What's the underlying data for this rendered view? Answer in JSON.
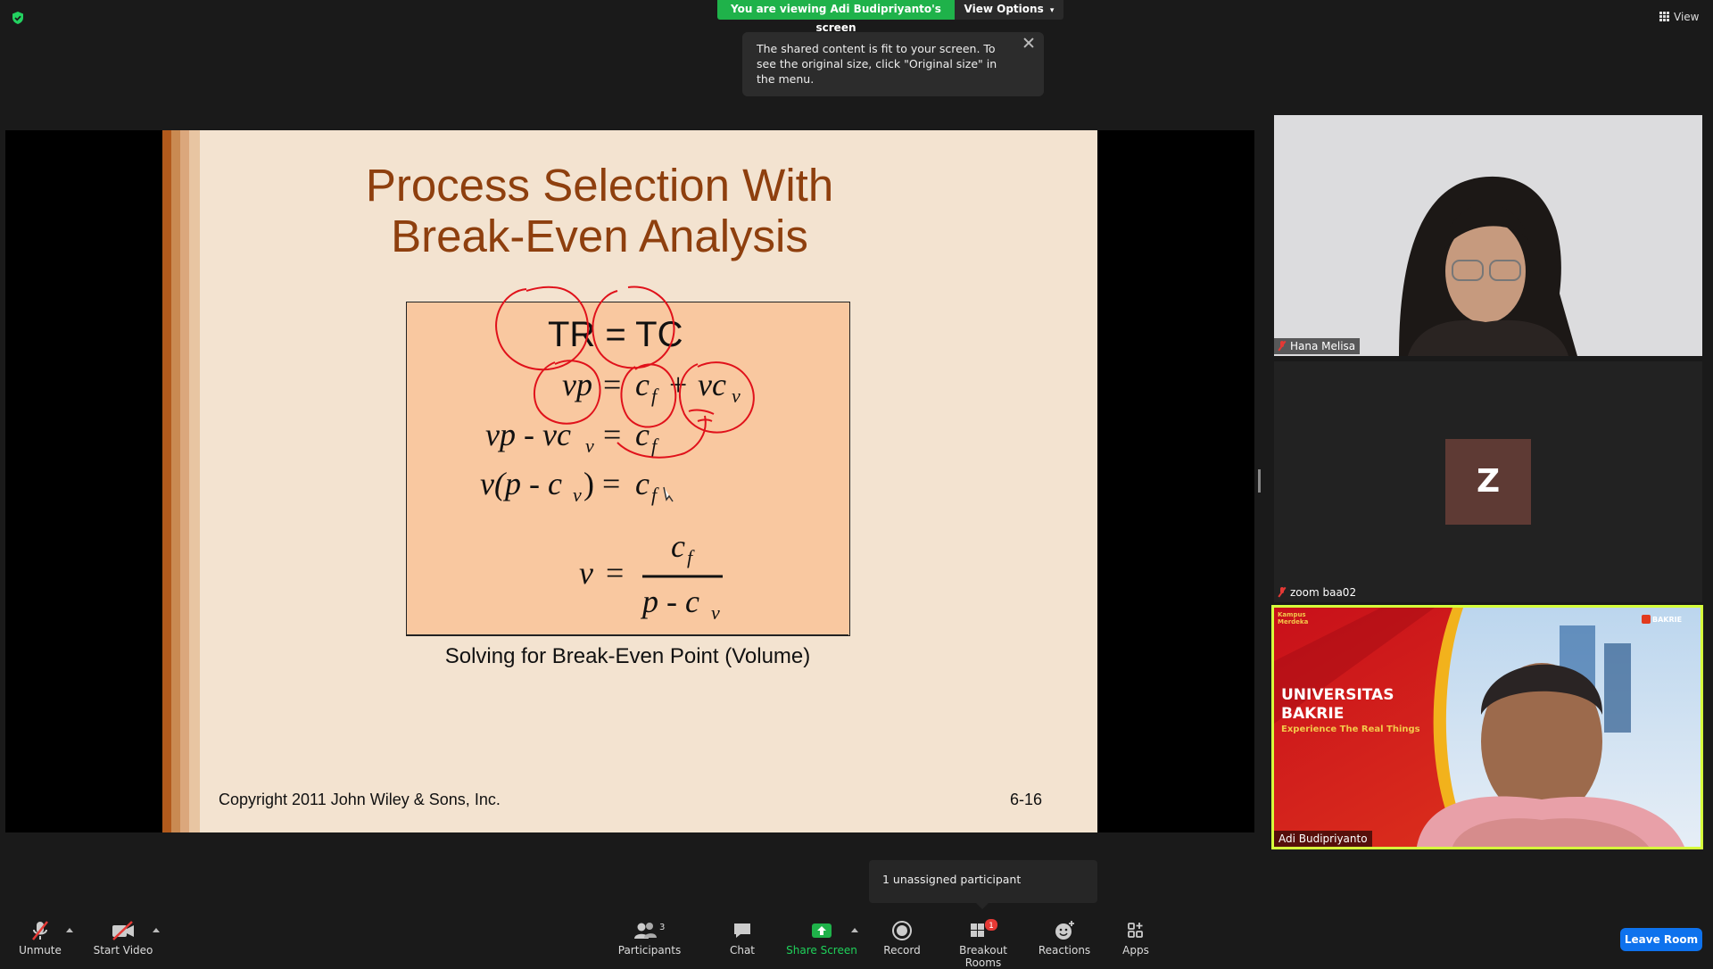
{
  "colors": {
    "background": "#1a1a1a",
    "banner_green": "#1fb24a",
    "active_speaker_border": "#d6ff3b",
    "leave_blue": "#0e72ed",
    "slide_title": "#8e3f0e",
    "formula_box": "#f9c8a0",
    "annotation_red": "#e0121b"
  },
  "top_bar": {
    "security_icon": "shield-check-icon",
    "viewing_banner": "You are viewing Adi Budipriyanto's screen",
    "view_options_label": "View Options",
    "tooltip_text": "The shared content is fit to your screen. To see the original size, click \"Original size\" in the menu.",
    "view_label": "View"
  },
  "slide": {
    "title_line1": "Process Selection With",
    "title_line2": "Break-Even Analysis",
    "formulas": {
      "line1": "TR = TC",
      "line2": "vp = c_f + vc_v",
      "line3": "vp - vc_v = c_f",
      "line4": "v(p - c_v) = c_f",
      "line5": "v = c_f / (p - c_v)"
    },
    "caption": "Solving for Break-Even Point (Volume)",
    "copyright": "Copyright 2011 John Wiley & Sons, Inc.",
    "page_number": "6-16"
  },
  "participants_tiles": [
    {
      "name": "Hana Melisa",
      "muted": true
    },
    {
      "name": "zoom baa02",
      "muted": true,
      "avatar_letter": "Z"
    },
    {
      "name": "Adi Budipriyanto",
      "muted": false,
      "active_speaker": true,
      "background_text": {
        "title_line1": "UNIVERSITAS",
        "title_line2": "BAKRIE",
        "tagline": "Experience The Real Things",
        "logo": "BAKRIE",
        "corner_logo": "Kampus Merdeka"
      }
    }
  ],
  "unassigned_notice": "1 unassigned participant",
  "toolbar": {
    "unmute": "Unmute",
    "start_video": "Start Video",
    "participants": "Participants",
    "participants_count": "3",
    "chat": "Chat",
    "share_screen": "Share Screen",
    "record": "Record",
    "breakout_rooms": "Breakout Rooms",
    "breakout_badge": "1",
    "reactions": "Reactions",
    "apps": "Apps",
    "leave_room": "Leave Room"
  }
}
